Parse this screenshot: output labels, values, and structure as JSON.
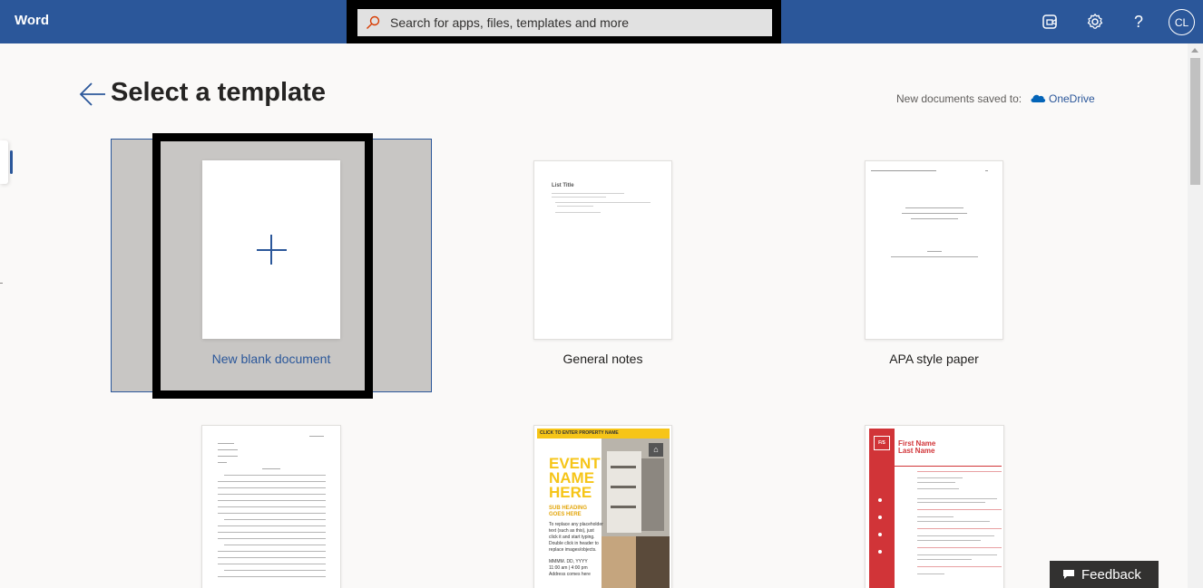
{
  "app": {
    "name": "Word"
  },
  "search": {
    "placeholder": "Search for apps, files, templates and more"
  },
  "header": {
    "avatar_initials": "CL"
  },
  "page": {
    "title": "Select a template",
    "saved_label": "New documents saved to:",
    "saved_location": "OneDrive"
  },
  "templates": [
    {
      "label": "New blank document"
    },
    {
      "label": "General notes"
    },
    {
      "label": "APA style paper"
    }
  ],
  "thumbs": {
    "notes_title": "List Title",
    "flyer": {
      "banner": "CLICK TO ENTER PROPERTY NAME",
      "headline1": "EVENT",
      "headline2": "NAME",
      "headline3": "HERE",
      "sub1": "SUB HEADING",
      "sub2": "GOES HERE",
      "body1": "To replace any placeholder",
      "body2": "text (such as this), just",
      "body3": "click it and start typing.",
      "body4": "Double click in header to",
      "body5": "replace images/objects.",
      "date": "MMMM. DD, YYYY",
      "time": "11:00 am | 4:00 pm",
      "address": "Address comes here"
    },
    "resume": {
      "monogram": "F/S",
      "first": "First Name",
      "last": "Last Name"
    }
  },
  "feedback": {
    "label": "Feedback"
  },
  "colors": {
    "brand": "#2b579a",
    "flyer_accent": "#f6c518",
    "resume_accent": "#d13438"
  }
}
